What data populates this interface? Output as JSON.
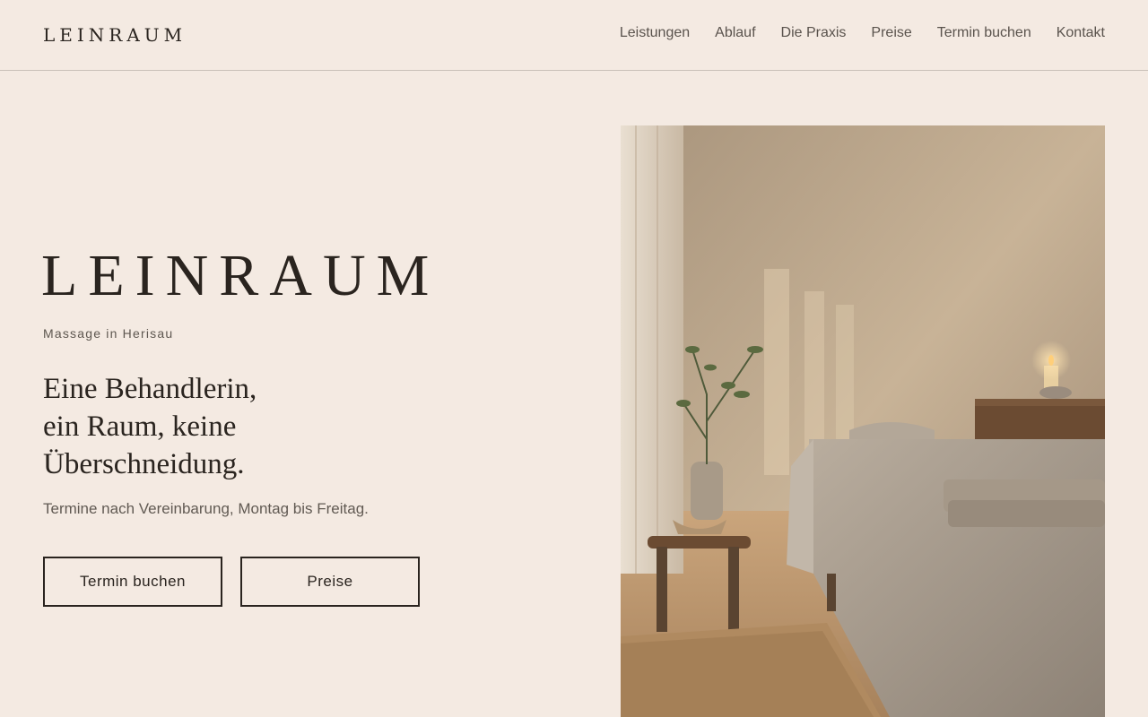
{
  "header": {
    "brand": "LEINRAUM",
    "nav": [
      "Leistungen",
      "Ablauf",
      "Die Praxis",
      "Preise",
      "Termin buchen",
      "Kontakt"
    ]
  },
  "hero": {
    "title": "LEINRAUM",
    "subtitle": "Massage in Herisau",
    "headline_lines": [
      "Eine Behandlerin,",
      "ein Raum, keine",
      "Überschneidung."
    ],
    "note": "Termine nach Vereinbarung, Montag bis Freitag.",
    "buttons": {
      "primary": "Termin buchen",
      "secondary": "Preise"
    }
  },
  "image": {
    "subject": "massage-room-photo"
  },
  "colors": {
    "background": "#f4eae2",
    "text": "#2a241f",
    "muted": "#5e5750"
  }
}
